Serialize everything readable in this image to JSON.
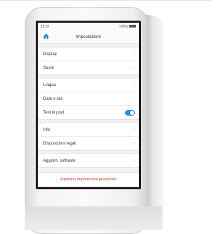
{
  "statusbar": {
    "time": "13:32",
    "battery": "100%"
  },
  "navbar": {
    "title": "Impostazioni",
    "home_icon": "home-icon"
  },
  "groups": [
    {
      "rows": [
        {
          "label": "Display"
        },
        {
          "label": "Suoni"
        }
      ]
    },
    {
      "rows": [
        {
          "label": "Lingua"
        },
        {
          "label": "Data e ora"
        },
        {
          "label": "Test in pool",
          "toggle": true
        }
      ]
    },
    {
      "rows": [
        {
          "label": "Info"
        },
        {
          "label": "Disposizioni legali"
        }
      ]
    },
    {
      "rows": [
        {
          "label": "Aggiorn. software"
        }
      ]
    }
  ],
  "reset": {
    "label": "Ripristino impostazioni predefinite",
    "color": "#e02d2d"
  },
  "colors": {
    "accent": "#1e8ff0",
    "bezel": "#1b1b1b"
  }
}
